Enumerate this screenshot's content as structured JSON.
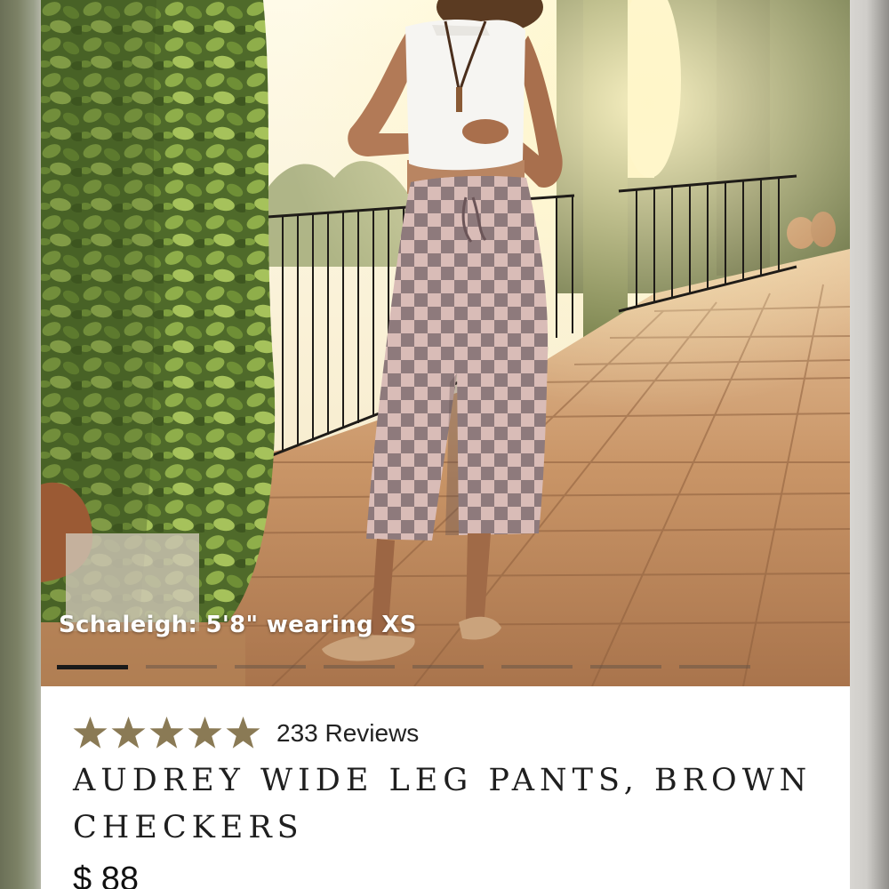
{
  "gallery": {
    "model_caption": "Schaleigh: 5'8\" wearing XS",
    "slide_count": 8,
    "active_slide": 1
  },
  "product": {
    "rating": 5,
    "review_count": "233 Reviews",
    "title": "AUDREY WIDE LEG PANTS, BROWN CHECKERS",
    "price": "$ 88"
  },
  "colors": {
    "star": "#8a7a55",
    "title": "#1f1f1f",
    "pattern_light": "#d9bcb7",
    "pattern_dark": "#8e7a7c"
  },
  "icons": {
    "rating": "star-icon"
  }
}
